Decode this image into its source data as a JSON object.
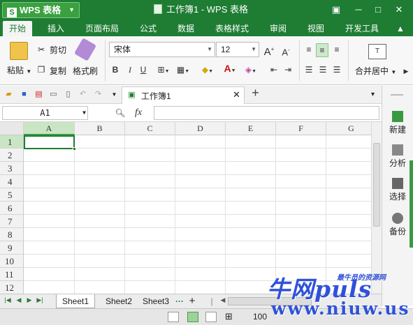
{
  "app": {
    "name": "WPS 表格",
    "logo_char": "S",
    "dropdown": "▼"
  },
  "window": {
    "title": "工作簿1 - WPS 表格",
    "controls": [
      "▣",
      "─",
      "□",
      "✕"
    ]
  },
  "tabs": [
    "开始",
    "插入",
    "页面布局",
    "公式",
    "数据",
    "表格样式",
    "审阅",
    "视图",
    "开发工具"
  ],
  "ribbon": {
    "paste": "粘贴",
    "cut": "剪切",
    "copy": "复制",
    "format_painter": "格式刷",
    "font_name": "宋体",
    "font_size": "12",
    "bold": "B",
    "italic": "I",
    "underline": "U",
    "merge_center": "合并居中"
  },
  "quick_access": {
    "doc_tab": "工作簿1",
    "new_tab": "+"
  },
  "formula_bar": {
    "name_box": "A1",
    "fx": "fx",
    "value": ""
  },
  "grid": {
    "columns": [
      "A",
      "B",
      "C",
      "D",
      "E",
      "F",
      "G"
    ],
    "rows": [
      "1",
      "2",
      "3",
      "4",
      "5",
      "6",
      "7",
      "8",
      "9",
      "10",
      "11",
      "12"
    ],
    "active_cell": "A1"
  },
  "right_panel": [
    {
      "label": "新建",
      "icon": "new-doc-icon"
    },
    {
      "label": "分析",
      "icon": "analysis-icon"
    },
    {
      "label": "选择",
      "icon": "select-icon"
    },
    {
      "label": "备份",
      "icon": "backup-icon"
    }
  ],
  "sheets": {
    "tabs": [
      "Sheet1",
      "Sheet2",
      "Sheet3"
    ],
    "more": "···",
    "add": "+"
  },
  "status": {
    "zoom": "100"
  },
  "watermark": {
    "brand": "牛网puls",
    "tagline": "最牛员的资源网",
    "url": "www.niuw.us"
  },
  "colors": {
    "title_green": "#1e7d33",
    "selection_green": "#c9e5c4",
    "watermark_blue": "#2f52d8"
  }
}
